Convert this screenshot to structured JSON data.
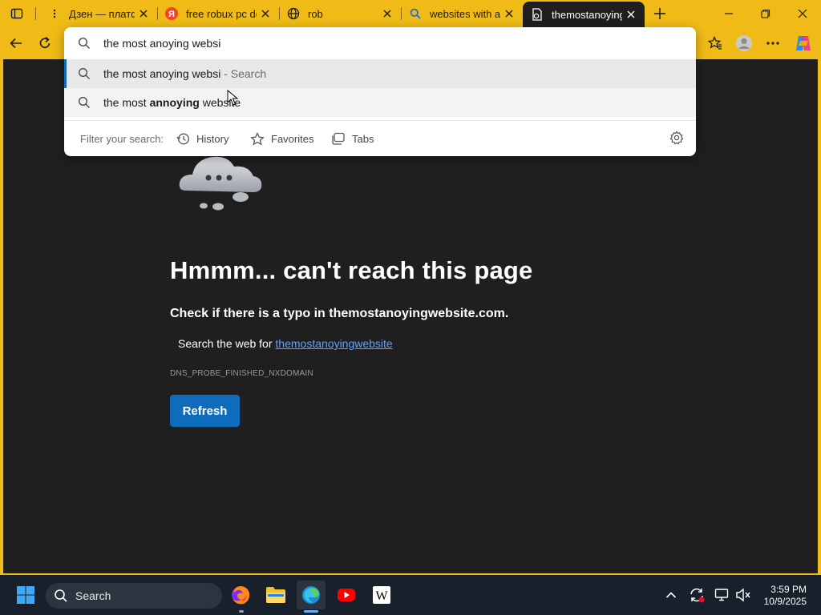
{
  "browser": {
    "tabs": [
      {
        "title": "Дзен — платфор",
        "favicon": "zen-icon"
      },
      {
        "title": "free robux pc do",
        "favicon": "yandex-icon"
      },
      {
        "title": "rob",
        "favicon": "globe-icon"
      },
      {
        "title": "websites with a lo",
        "favicon": "search-icon"
      },
      {
        "title": "themostanoyingw",
        "favicon": "broken-page-icon"
      }
    ],
    "active_tab": 4,
    "accent_color": "#f0bb17"
  },
  "omnibox": {
    "query": "the most anoying websi",
    "suggestions": [
      {
        "main": "the most anoying websi",
        "suffix": "- Search"
      },
      {
        "prefix": "the most ",
        "bold": "annoying",
        "rest": " website"
      }
    ],
    "filter_label": "Filter your search:",
    "filters": [
      "History",
      "Favorites",
      "Tabs"
    ]
  },
  "error_page": {
    "title": "Hmmm... can't reach this page",
    "check_text": "Check if there is a typo in themostanoyingwebsite.com.",
    "search_prefix": "Search the web for",
    "search_link": "themostanoyingwebsite",
    "error_code": "DNS_PROBE_FINISHED_NXDOMAIN",
    "refresh_label": "Refresh"
  },
  "taskbar": {
    "search_label": "Search",
    "time": "3:59 PM",
    "date": "10/9/2025",
    "apps": [
      "firefox",
      "file-explorer",
      "edge",
      "youtube",
      "wikipedia"
    ]
  }
}
